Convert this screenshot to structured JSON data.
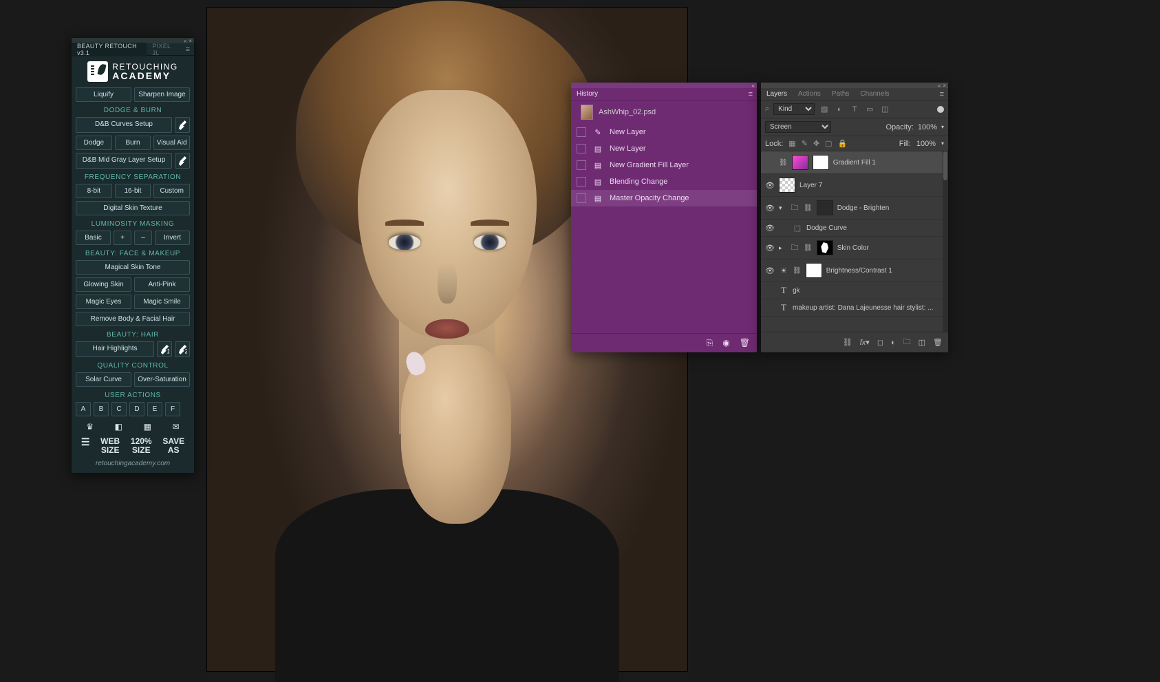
{
  "retouch_panel": {
    "tabs": [
      "BEAUTY RETOUCH v3.1",
      "PIXEL JL"
    ],
    "active_tab": 0,
    "logo": {
      "top": "RETOUCHING",
      "bottom": "ACADEMY"
    },
    "top_row": {
      "liquify": "Liquify",
      "sharpen": "Sharpen Image"
    },
    "sections": {
      "dodge_burn": {
        "header": "DODGE & BURN",
        "curves_setup": "D&B  Curves Setup",
        "dodge": "Dodge",
        "burn": "Burn",
        "visual_aid": "Visual Aid",
        "midgray": "D&B Mid Gray Layer Setup"
      },
      "freq_sep": {
        "header": "FREQUENCY  SEPARATION",
        "bit8": "8-bit",
        "bit16": "16-bit",
        "custom": "Custom",
        "skin": "Digital Skin Texture"
      },
      "lum_mask": {
        "header": "LUMINOSITY  MASKING",
        "basic": "Basic",
        "plus": "+",
        "minus": "–",
        "invert": "Invert"
      },
      "face_makeup": {
        "header": "BEAUTY: FACE & MAKEUP",
        "magical_skin": "Magical Skin Tone",
        "glowing": "Glowing Skin",
        "antipink": "Anti-Pink",
        "eyes": "Magic Eyes",
        "smile": "Magic Smile",
        "remove_hair": "Remove Body & Facial Hair"
      },
      "hair": {
        "header": "BEAUTY: HAIR",
        "highlights": "Hair Highlights"
      },
      "quality": {
        "header": "QUALITY CONTROL",
        "solar": "Solar Curve",
        "oversat": "Over-Saturation"
      },
      "user_actions": {
        "header": "USER  ACTIONS",
        "letters": [
          "A",
          "B",
          "C",
          "D",
          "E",
          "F"
        ]
      }
    },
    "bottom_tools_row1": [
      "crown-icon",
      "levels-icon",
      "contact-sheet-icon",
      "envelope-icon"
    ],
    "bottom_tools_row2": [
      {
        "name": "layers-icon",
        "label": ""
      },
      {
        "name": "web-size",
        "label": "WEB\nSIZE"
      },
      {
        "name": "120-size",
        "label": "120%\nSIZE"
      },
      {
        "name": "save-as",
        "label": "SAVE\nAS"
      }
    ],
    "url": "retouchingacademy.com"
  },
  "history_panel": {
    "title": "History",
    "document": "AshWhip_02.psd",
    "items": [
      {
        "icon": "brush",
        "label": "New Layer"
      },
      {
        "icon": "doc",
        "label": "New Layer"
      },
      {
        "icon": "doc",
        "label": "New Gradient Fill Layer"
      },
      {
        "icon": "doc",
        "label": "Blending Change"
      },
      {
        "icon": "doc",
        "label": "Master Opacity Change"
      }
    ],
    "selected": 4,
    "footer_icons": [
      "new-doc-icon",
      "camera-icon",
      "trash-icon"
    ]
  },
  "layers_panel": {
    "tabs": [
      "Layers",
      "Actions",
      "Paths",
      "Channels"
    ],
    "active_tab": 0,
    "filter": {
      "kind": "Kind"
    },
    "blend": {
      "mode": "Screen",
      "opacity_label": "Opacity:",
      "opacity": "100%"
    },
    "lock": {
      "label": "Lock:",
      "fill_label": "Fill:",
      "fill": "100%"
    },
    "layers": [
      {
        "vis": false,
        "thumb": "grad",
        "mask": "mask",
        "name": "Gradient Fill 1",
        "selected": true,
        "link": true
      },
      {
        "vis": true,
        "thumb": "checker",
        "name": "Layer 7"
      },
      {
        "vis": true,
        "arr": "▾",
        "icon": "folder",
        "link": true,
        "thumb": "dark",
        "name": "Dodge - Brighten"
      },
      {
        "vis": true,
        "indent": 1,
        "icon": "curves",
        "name": "Dodge Curve"
      },
      {
        "vis": true,
        "arr": "▸",
        "icon": "folder",
        "link": true,
        "thumb": "maskshape",
        "name": "Skin Color"
      },
      {
        "vis": true,
        "icon": "brightness",
        "link": true,
        "thumb": "mask",
        "name": "Brightness/Contrast 1"
      },
      {
        "vis": false,
        "icon": "T",
        "name": "gk"
      },
      {
        "vis": false,
        "icon": "T",
        "name": "makeup artist: Dana Lajeunesse hair stylist: ..."
      }
    ],
    "footer_icons": [
      "link-icon",
      "fx-icon",
      "mask-icon",
      "adjustment-icon",
      "folder-icon",
      "new-layer-icon",
      "trash-icon"
    ]
  }
}
